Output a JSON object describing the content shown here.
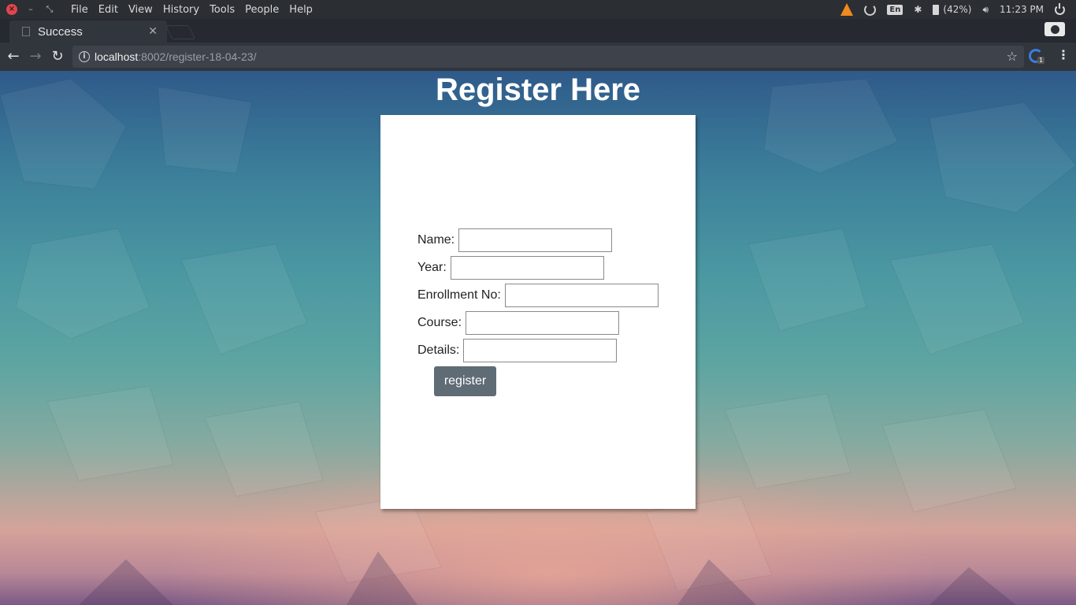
{
  "system_bar": {
    "menus": [
      "File",
      "Edit",
      "View",
      "History",
      "Tools",
      "People",
      "Help"
    ],
    "tray": {
      "keyboard_layout": "En",
      "battery": "(42%)",
      "time": "11:23 PM"
    }
  },
  "browser": {
    "tab_title": "Success",
    "url_host": "localhost",
    "url_rest": ":8002/register-18-04-23/",
    "extension_badge": "1"
  },
  "page": {
    "title": "Register Here",
    "form": {
      "fields": [
        {
          "label": "Name:",
          "value": ""
        },
        {
          "label": "Year:",
          "value": ""
        },
        {
          "label": "Enrollment No:",
          "value": ""
        },
        {
          "label": "Course:",
          "value": ""
        },
        {
          "label": "Details:",
          "value": ""
        }
      ],
      "submit_label": "register"
    }
  },
  "colors": {
    "submit_button": "#5f6b75",
    "card": "#ffffff",
    "window_close": "#e0464e"
  }
}
